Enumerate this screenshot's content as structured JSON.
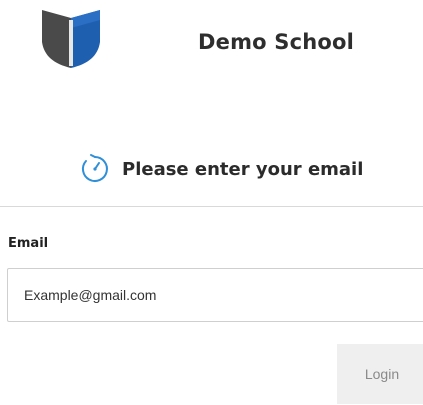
{
  "header": {
    "school_name": "Demo School",
    "logo_icon": "shield-logo-icon"
  },
  "prompt": {
    "icon": "timer-icon",
    "text": "Please enter your email"
  },
  "form": {
    "email_label": "Email",
    "email_placeholder": "Example@gmail.com",
    "email_value": "",
    "login_label": "Login"
  },
  "colors": {
    "shield_blue": "#1f5fb0",
    "shield_gray": "#4a4a4a",
    "icon_blue": "#2f8fd8",
    "button_bg": "#efefef",
    "divider": "#d9d9d9"
  }
}
